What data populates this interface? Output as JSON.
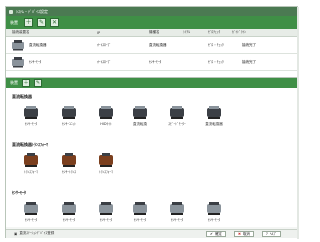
{
  "window": {
    "title": "ｼｽﾃﾑ・ﾃﾞﾊﾞｲｽ設定"
  },
  "toolbar": {
    "label": "装置",
    "buttons": [
      "add",
      "edit",
      "delete"
    ]
  },
  "top_table": {
    "headers": [
      "接続装置名",
      "IP",
      "機種名",
      "ｼﾘｱﾙ",
      "ｾﾞﾛﾁｪｯｸ",
      "ｶﾞｲﾄﾞﾗｲﾝ"
    ],
    "rows": [
      [
        "直流転換器",
        "ｵｰﾄｽﾛｰﾌﾞ",
        "直流転換器",
        "ｾﾞﾛ・ﾁｪｯｸ",
        "接続完了"
      ],
      [
        "ｾﾝｻｰﾓｰﾀ",
        "ｵｰﾄｽﾛｰﾌﾞ",
        "ｾﾝｻｰﾓｰﾀ",
        "ｾﾞﾛ・ﾁｪｯｸ",
        "接続完了"
      ]
    ]
  },
  "pane2": {
    "label": "装置",
    "groups": [
      {
        "title": "直流転換器",
        "items": [
          "ｾﾝｻｰﾓｰﾀ",
          "ｾﾝｻｰﾕﾆｯﾄ",
          "HIDﾗｲﾄ",
          "直流転換",
          "ｽﾋﾟｰﾄﾞﾓｰﾀｰ",
          "直流転換器"
        ]
      },
      {
        "title": "直流転換器ﾄﾗﾝｽﾌｫｰﾏ",
        "items": [
          "ﾄﾗﾝｽﾌｫｰﾏ",
          "ｾﾝｻｰﾄﾗﾝｽ",
          "ﾄﾗﾝｽﾌｫｰﾏ"
        ]
      },
      {
        "title": "ｾﾝｻｰﾓｰﾀ",
        "items": [
          "ｾﾝｻｰﾓｰﾀ",
          "ｾﾝｻｰﾓｰﾀ",
          "ｾﾝｻｰﾓｰﾀ",
          "ｾﾝｻｰﾓｰﾀ",
          "ｾﾝｻｰﾓｰﾀ",
          "ｾﾝｻｰﾓｰﾀ"
        ]
      }
    ]
  },
  "statusbar": {
    "left_text": "直流ｽﾃｰｼｮﾝﾃﾞﾊﾞｲｽ登録",
    "ok_label": "確定",
    "cancel_label": "取消",
    "help_label": "ﾍﾙﾌﾟ"
  },
  "colors": {
    "green": "#3f8f46",
    "dark_green": "#2c6b32",
    "device_dark": "#3b3f45",
    "device_light": "#8a939b",
    "brown": "#7b3f1e"
  },
  "icons": [
    "plus-icon",
    "edit-icon",
    "delete-icon",
    "pump-device-icon",
    "motor-device-icon",
    "transformer-device-icon"
  ]
}
